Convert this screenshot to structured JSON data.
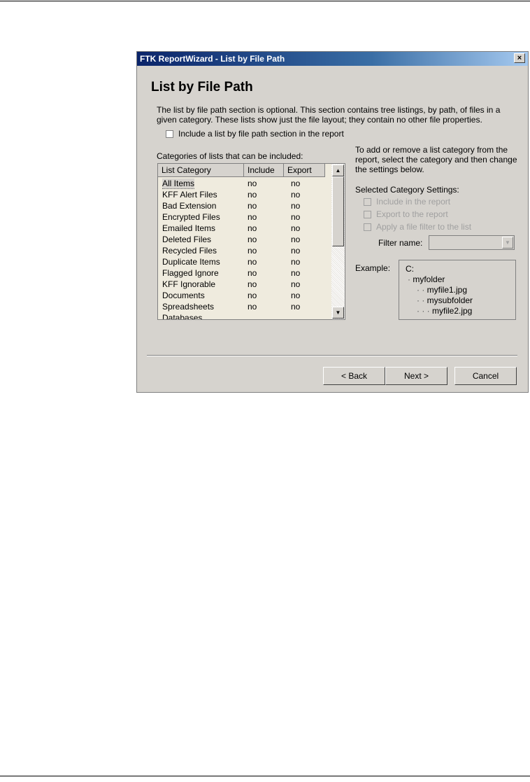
{
  "window": {
    "title": "FTK ReportWizard - List by File Path",
    "close_glyph": "×"
  },
  "page": {
    "heading": "List by File Path",
    "description": "The list by file path section is optional. This section contains tree listings, by path, of files in a given category. These lists show just the file layout; they contain no other file properties.",
    "include_checkbox_label": "Include a list by file path section in the report"
  },
  "list": {
    "caption": "Categories of lists that can be included:",
    "columns": [
      "List Category",
      "Include",
      "Export"
    ],
    "rows": [
      {
        "category": "All Items",
        "include": "no",
        "export": "no"
      },
      {
        "category": "KFF Alert Files",
        "include": "no",
        "export": "no"
      },
      {
        "category": "Bad Extension",
        "include": "no",
        "export": "no"
      },
      {
        "category": "Encrypted Files",
        "include": "no",
        "export": "no"
      },
      {
        "category": "Emailed Items",
        "include": "no",
        "export": "no"
      },
      {
        "category": "Deleted Files",
        "include": "no",
        "export": "no"
      },
      {
        "category": "Recycled Files",
        "include": "no",
        "export": "no"
      },
      {
        "category": "Duplicate Items",
        "include": "no",
        "export": "no"
      },
      {
        "category": "Flagged Ignore",
        "include": "no",
        "export": "no"
      },
      {
        "category": "KFF Ignorable",
        "include": "no",
        "export": "no"
      },
      {
        "category": "Documents",
        "include": "no",
        "export": "no"
      },
      {
        "category": "Spreadsheets",
        "include": "no",
        "export": "no"
      },
      {
        "category": "Databases",
        "include": "",
        "export": ""
      }
    ]
  },
  "settings": {
    "help_text": "To add or remove a list category from the report, select the category and then change the settings below.",
    "caption": "Selected Category Settings:",
    "include_label": "Include in the report",
    "export_label": "Export to the report",
    "filter_apply_label": "Apply a file filter to the list",
    "filter_name_label": "Filter name:",
    "filter_name_value": ""
  },
  "example": {
    "label": "Example:",
    "lines": [
      {
        "dots": "",
        "text": "C:"
      },
      {
        "dots": "·",
        "text": "myfolder"
      },
      {
        "dots": "·   ·",
        "text": "myfile1.jpg"
      },
      {
        "dots": "·   ·",
        "text": "mysubfolder"
      },
      {
        "dots": "·   ·   ·",
        "text": "myfile2.jpg"
      }
    ]
  },
  "buttons": {
    "back": "< Back",
    "next": "Next >",
    "cancel": "Cancel"
  },
  "colors": {
    "title_bar": "#0a246a",
    "dialog_face": "#d6d3ce",
    "list_background": "#efebde"
  }
}
